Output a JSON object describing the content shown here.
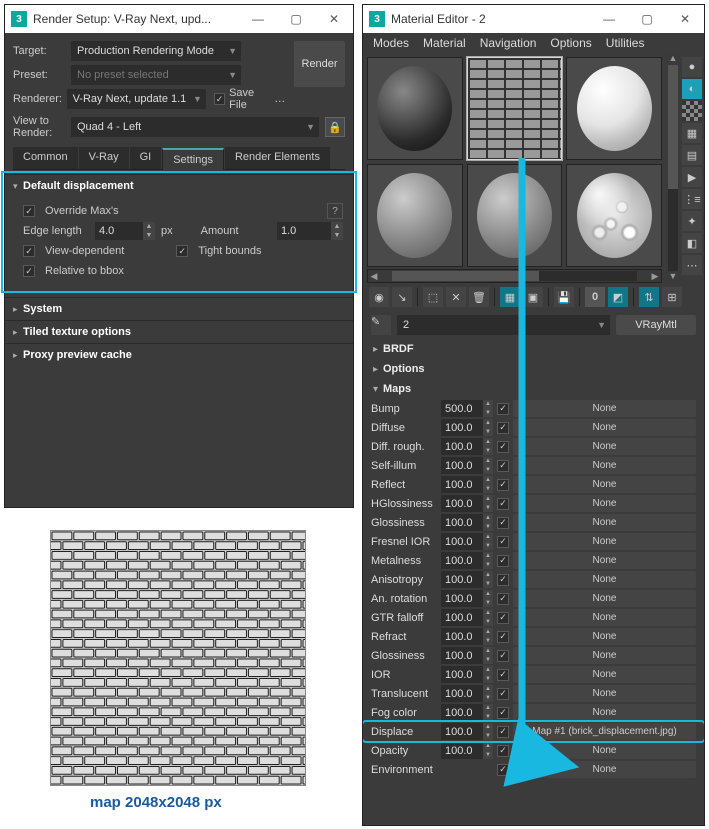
{
  "render_setup": {
    "title": "Render Setup: V-Ray Next, upd...",
    "rows": {
      "target": {
        "label": "Target:",
        "value": "Production Rendering Mode"
      },
      "preset": {
        "label": "Preset:",
        "value": "No preset selected"
      },
      "renderer": {
        "label": "Renderer:",
        "value": "V-Ray Next, update 1.1"
      },
      "save_file_label": "Save File",
      "view_lbl_1": "View to",
      "view_lbl_2": "Render:",
      "view_value": "Quad 4 - Left",
      "render_btn": "Render"
    },
    "tabs": [
      "Common",
      "V-Ray",
      "GI",
      "Settings",
      "Render Elements"
    ],
    "active_tab": 3,
    "sections": {
      "default_displacement": {
        "title": "Default displacement",
        "override": "Override Max's",
        "edge_length_lbl": "Edge length",
        "edge_length_val": "4.0",
        "px": "px",
        "amount_lbl": "Amount",
        "amount_val": "1.0",
        "view_dependent": "View-dependent",
        "tight_bounds": "Tight bounds",
        "relative": "Relative to bbox"
      },
      "system": "System",
      "tiled": "Tiled texture options",
      "proxy": "Proxy preview cache"
    }
  },
  "texture_caption": "map 2048x2048 px",
  "material_editor": {
    "title": "Material Editor - 2",
    "menu": [
      "Modes",
      "Material",
      "Navigation",
      "Options",
      "Utilities"
    ],
    "slot_id": "2",
    "type": "VRayMtl",
    "rollouts": {
      "brdf": "BRDF",
      "options": "Options",
      "maps": "Maps"
    },
    "maps": [
      {
        "label": "Bump",
        "value": "500.0",
        "checked": true,
        "slot": "None"
      },
      {
        "label": "Diffuse",
        "value": "100.0",
        "checked": true,
        "slot": "None"
      },
      {
        "label": "Diff. rough.",
        "value": "100.0",
        "checked": true,
        "slot": "None"
      },
      {
        "label": "Self-illum",
        "value": "100.0",
        "checked": true,
        "slot": "None"
      },
      {
        "label": "Reflect",
        "value": "100.0",
        "checked": true,
        "slot": "None"
      },
      {
        "label": "HGlossiness",
        "value": "100.0",
        "checked": true,
        "slot": "None"
      },
      {
        "label": "Glossiness",
        "value": "100.0",
        "checked": true,
        "slot": "None"
      },
      {
        "label": "Fresnel IOR",
        "value": "100.0",
        "checked": true,
        "slot": "None"
      },
      {
        "label": "Metalness",
        "value": "100.0",
        "checked": true,
        "slot": "None"
      },
      {
        "label": "Anisotropy",
        "value": "100.0",
        "checked": true,
        "slot": "None"
      },
      {
        "label": "An. rotation",
        "value": "100.0",
        "checked": true,
        "slot": "None"
      },
      {
        "label": "GTR falloff",
        "value": "100.0",
        "checked": true,
        "slot": "None"
      },
      {
        "label": "Refract",
        "value": "100.0",
        "checked": true,
        "slot": "None"
      },
      {
        "label": "Glossiness",
        "value": "100.0",
        "checked": true,
        "slot": "None"
      },
      {
        "label": "IOR",
        "value": "100.0",
        "checked": true,
        "slot": "None"
      },
      {
        "label": "Translucent",
        "value": "100.0",
        "checked": true,
        "slot": "None"
      },
      {
        "label": "Fog color",
        "value": "100.0",
        "checked": true,
        "slot": "None"
      },
      {
        "label": "Displace",
        "value": "100.0",
        "checked": true,
        "slot": "Map #1 (brick_displacement.jpg)",
        "highlight": true
      },
      {
        "label": "Opacity",
        "value": "100.0",
        "checked": true,
        "slot": "None"
      },
      {
        "label": "Environment",
        "value": "",
        "checked": true,
        "slot": "None",
        "nospin": true
      }
    ]
  }
}
